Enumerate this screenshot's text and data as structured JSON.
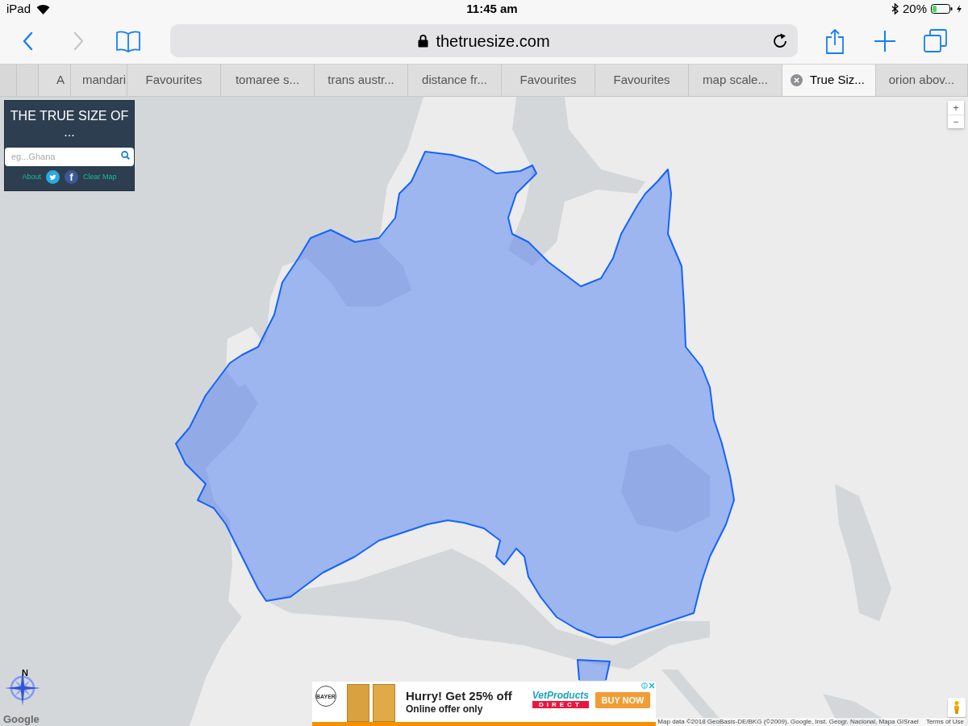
{
  "status_bar": {
    "device": "iPad",
    "time": "11:45 am",
    "battery": "20%"
  },
  "toolbar": {
    "nav_buttons": [
      {
        "kind": "back",
        "disabled": false
      },
      {
        "kind": "forward",
        "disabled": true
      }
    ],
    "address": {
      "url": "thetruesize.com",
      "secure": true
    }
  },
  "tabs": [
    {
      "label": "A",
      "selected": false
    },
    {
      "label": "mandari",
      "selected": false
    },
    {
      "label": "Favourites",
      "selected": false
    },
    {
      "label": "tomaree s...",
      "selected": false
    },
    {
      "label": "trans austr...",
      "selected": false
    },
    {
      "label": "distance fr...",
      "selected": false
    },
    {
      "label": "Favourites",
      "selected": false
    },
    {
      "label": "Favourites",
      "selected": false
    },
    {
      "label": "map scale...",
      "selected": false
    },
    {
      "label": "True Siz...",
      "selected": true
    },
    {
      "label": "orion abov...",
      "selected": false
    }
  ],
  "search_panel": {
    "title": "THE TRUE SIZE OF ...",
    "placeholder": "eg...Ghana",
    "links": [
      {
        "kind": "text",
        "label": "About"
      },
      {
        "kind": "twitter"
      },
      {
        "kind": "facebook",
        "glyph": "f"
      },
      {
        "kind": "text",
        "label": "Clear Map"
      }
    ]
  },
  "map": {
    "zoom_buttons": [
      "+",
      "−"
    ],
    "compass_label": "N",
    "logo": "Google",
    "attribution": "Map data ©2018 GeoBasis-DE/BKG (©2009), Google, Inst. Geogr. Nacional, Mapa GISrael",
    "terms": "Terms of Use"
  },
  "ad": {
    "brand": "BAYER",
    "headline": "Hurry! Get 25% off",
    "subline": "Online offer only",
    "seller": "VetProducts",
    "seller_tagline": "DIRECT",
    "button": "BUY NOW"
  }
}
